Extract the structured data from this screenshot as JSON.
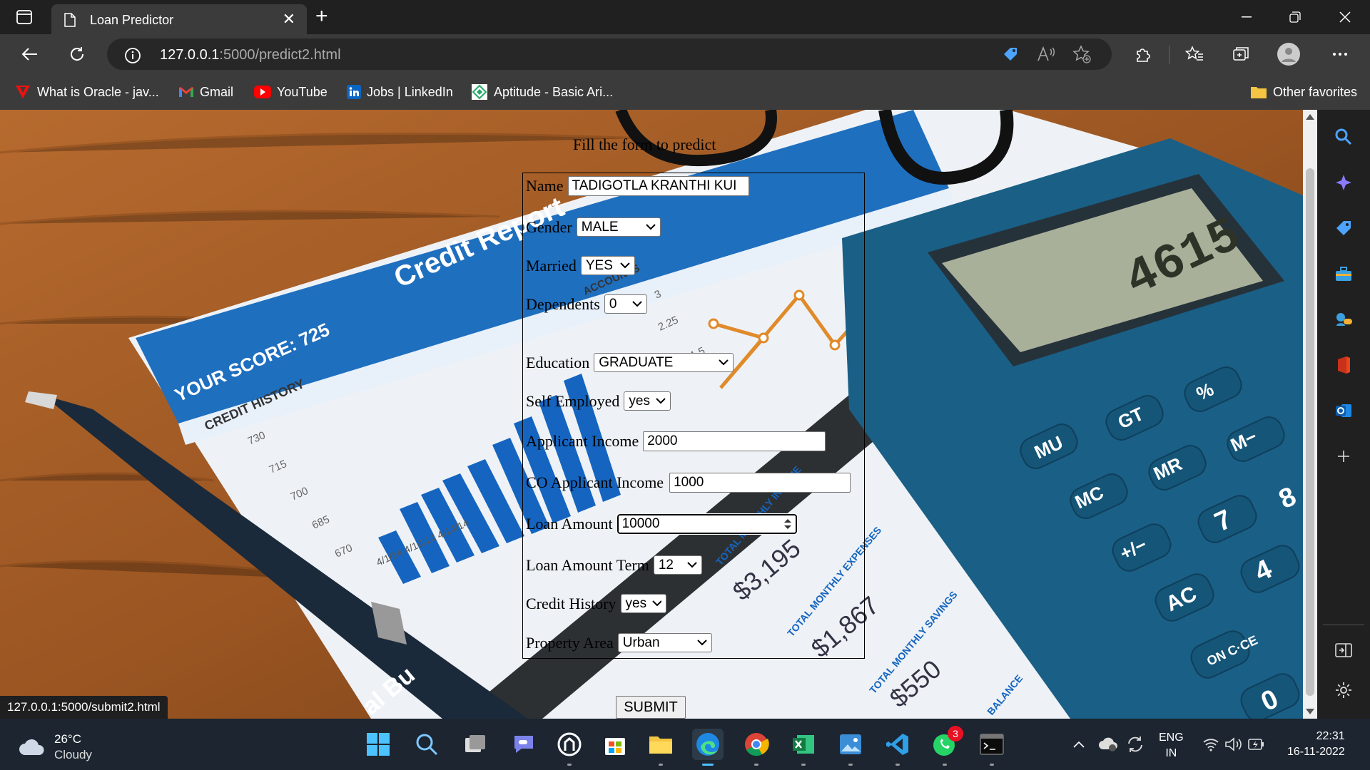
{
  "browser": {
    "tab_title": "Loan Predictor",
    "url_host": "127.0.0.1",
    "url_path": ":5000/predict2.html",
    "status_url": "127.0.0.1:5000/submit2.html"
  },
  "favorites": [
    {
      "label": "What is Oracle - jav...",
      "icon": "oracle-icon"
    },
    {
      "label": "Gmail",
      "icon": "gmail-icon"
    },
    {
      "label": "YouTube",
      "icon": "youtube-icon"
    },
    {
      "label": "Jobs | LinkedIn",
      "icon": "linkedin-icon"
    },
    {
      "label": "Aptitude - Basic Ari...",
      "icon": "aptitude-icon"
    }
  ],
  "other_favorites": "Other favorites",
  "form": {
    "title": "Fill the form to predict",
    "name_label": "Name",
    "name_value": "TADIGOTLA KRANTHI KUI",
    "gender_label": "Gender",
    "gender_value": "MALE",
    "married_label": "Married",
    "married_value": "YES",
    "dependents_label": "Dependents",
    "dependents_value": "0",
    "education_label": "Education",
    "education_value": "GRADUATE",
    "self_employed_label": "Self Employed",
    "self_employed_value": "yes",
    "applicant_income_label": "Applicant Income",
    "applicant_income_value": "2000",
    "co_income_label": "CO Applicant Income",
    "co_income_value": "1000",
    "loan_amount_label": "Loan Amount",
    "loan_amount_value": "10000",
    "loan_term_label": "Loan Amount Term",
    "loan_term_value": "12",
    "credit_history_label": "Credit History",
    "credit_history_value": "yes",
    "property_area_label": "Property Area",
    "property_area_value": "Urban",
    "submit_label": "SUBMIT"
  },
  "background": {
    "report_title": "Credit Report",
    "score": "YOUR SCORE: 725",
    "history": "CREDIT HISTORY",
    "yticks": [
      "730",
      "715",
      "700",
      "685",
      "670"
    ],
    "dates": "4/1/14 4/10/14 4/14/14",
    "accounts": "ACCOUNTS",
    "line_ticks": [
      "3",
      "2.25",
      "1.5"
    ],
    "income": "TOTAL MONTHLY INCOME",
    "income_value": "$3,195",
    "expenses": "TOTAL MONTHLY EXPENSES",
    "expenses_value": "$1,867",
    "savings": "TOTAL MONTHLY SAVINGS",
    "savings_value": "$550",
    "balance": "BALANCE",
    "budget": "al Bu",
    "calc_display": "4615",
    "calc_keys": [
      "MU",
      "GT",
      "%",
      "MC",
      "MR",
      "M−",
      "+/−",
      "7",
      "8",
      "AC",
      "4",
      "ON C·CE",
      "0"
    ]
  },
  "taskbar": {
    "weather_temp": "26°C",
    "weather_desc": "Cloudy",
    "lang": "ENG",
    "region": "IN",
    "time": "22:31",
    "date": "16-11-2022",
    "whatsapp_badge": "3"
  }
}
